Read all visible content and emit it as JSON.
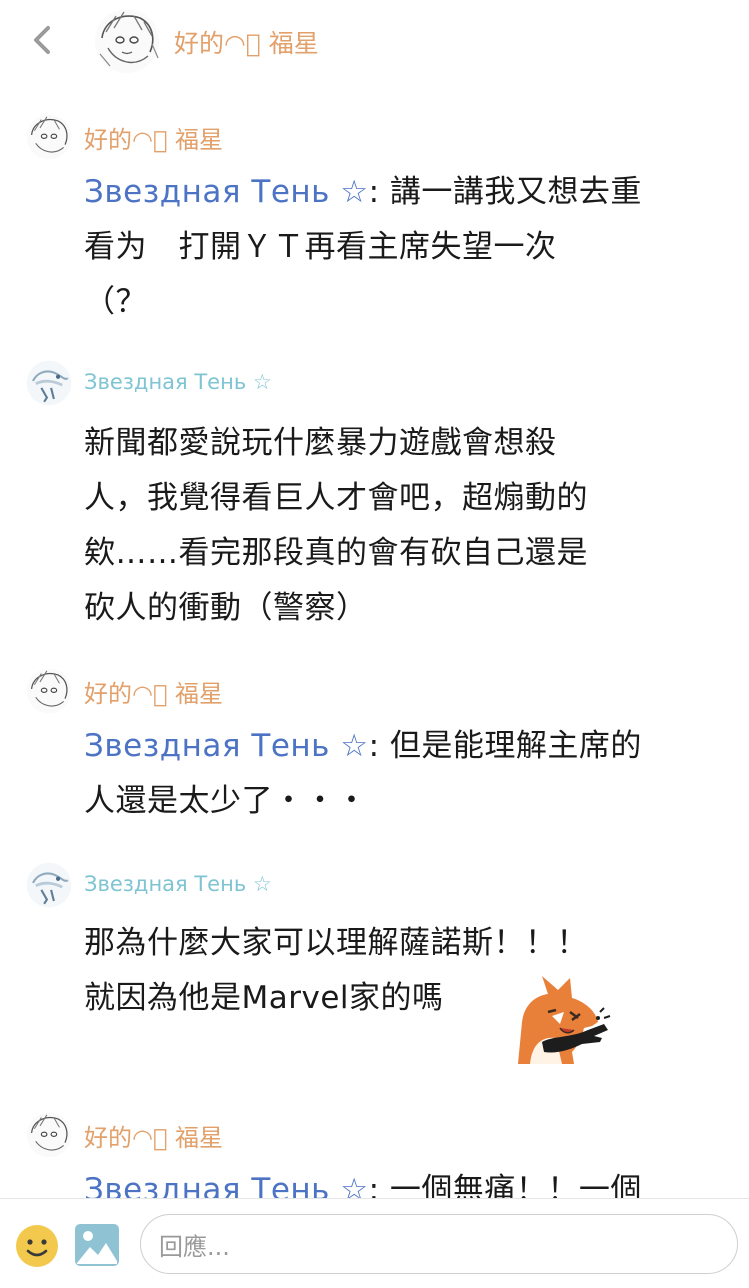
{
  "header": {
    "title": "好的◠ͦ 福星"
  },
  "messages": [
    {
      "author": "好的◠ͦ 福星",
      "mention": "Звездная Тень ☆",
      "text_lines": [
        ": 講一講我又想去重",
        "看为　打開ＹＴ再看主席失望一次",
        "（？"
      ]
    },
    {
      "author": "Звездная Тень ☆",
      "text_lines": [
        "新聞都愛說玩什麼暴力遊戲會想殺",
        "人，我覺得看巨人才會吧，超煽動的",
        "欸……看完那段真的會有砍自己還是",
        "砍人的衝動（警察）"
      ]
    },
    {
      "author": "好的◠ͦ 福星",
      "mention": "Звездная Тень ☆",
      "text_lines": [
        ": 但是能理解主席的",
        "人還是太少了・・・"
      ]
    },
    {
      "author": "Звездная Тень ☆",
      "text_lines": [
        "那為什麼大家可以理解薩諾斯！！！",
        "就因為他是Marvel家的嗎"
      ],
      "sticker": "fox-pointing-sticker"
    },
    {
      "author": "好的◠ͦ 福星",
      "mention": "Звездная Тень ☆",
      "text_lines": [
        ": 一個無痛！！一個"
      ]
    }
  ],
  "footer": {
    "reply_placeholder": "回應...",
    "emoji_icon": "smiley-icon",
    "image_icon": "image-icon"
  },
  "colors": {
    "orange_name": "#e2a06a",
    "teal_name": "#7ec4d2",
    "mention": "#4d74c4"
  }
}
